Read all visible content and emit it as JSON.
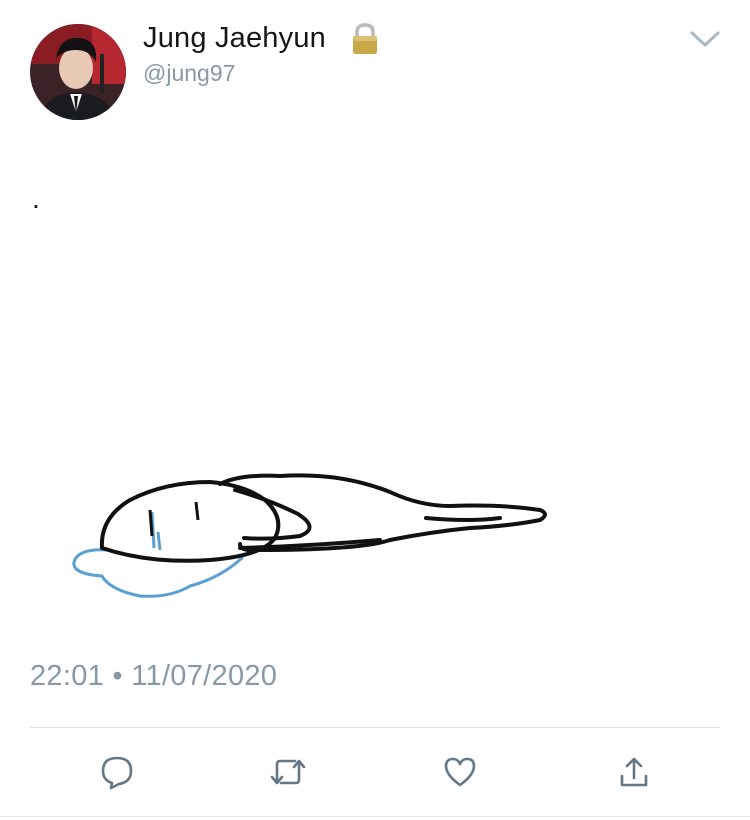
{
  "tweet": {
    "display_name": "Jung Jaehyun",
    "username": "@jung97",
    "text": ".",
    "timestamp": "22:01 • 11/07/2020"
  },
  "icons": {
    "lock": "lock-icon",
    "caret": "chevron-down-icon",
    "reply": "reply-icon",
    "retweet": "retweet-icon",
    "like": "heart-icon",
    "share": "share-icon"
  },
  "colors": {
    "text": "#14171a",
    "muted": "#8899a6",
    "action_icons": "#657786",
    "drawing_line": "#111111",
    "drawing_tears": "#5a9fd4"
  }
}
